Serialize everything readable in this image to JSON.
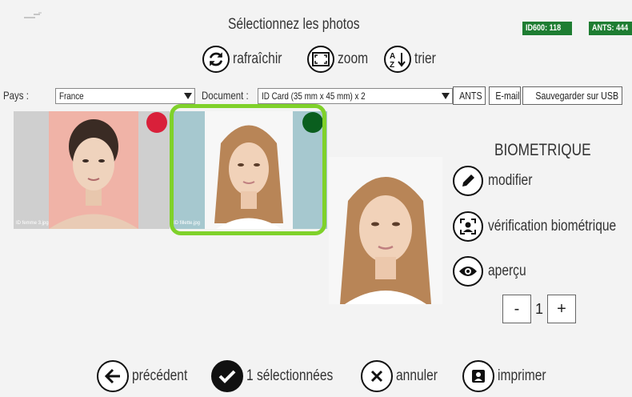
{
  "header": {
    "title": "Sélectionnez les photos",
    "badges": {
      "id600": "ID600: 118",
      "ants": "ANTS: 444"
    }
  },
  "toolbar": {
    "refresh": "rafraîchir",
    "zoom": "zoom",
    "sort": "trier"
  },
  "filters": {
    "country_label": "Pays :",
    "country_value": "France",
    "document_label": "Document :",
    "document_value": "ID Card (35 mm x 45 mm) x 2",
    "btn_ants": "ANTS",
    "btn_email": "E-mail",
    "btn_usb": "Sauvegarder sur USB"
  },
  "photos": [
    {
      "filename": "ID femme 3.jpg",
      "status": "red",
      "status_color": "#d9203a",
      "bg": "#f0b3a7"
    },
    {
      "filename": "ID fillette.jpg",
      "status": "green",
      "status_color": "#0a5e1e",
      "bg": "#a6c8cf",
      "selected": true
    }
  ],
  "biometric": {
    "title": "BIOMETRIQUE",
    "edit": "modifier",
    "verify": "vérification biométrique",
    "preview": "aperçu"
  },
  "quantity": {
    "minus": "-",
    "value": "1",
    "plus": "+"
  },
  "footer": {
    "previous": "précédent",
    "selected": "1 sélectionnées",
    "cancel": "annuler",
    "print": "imprimer"
  },
  "colors": {
    "accent_green": "#7fd12a",
    "badge_green": "#1e7d32"
  }
}
